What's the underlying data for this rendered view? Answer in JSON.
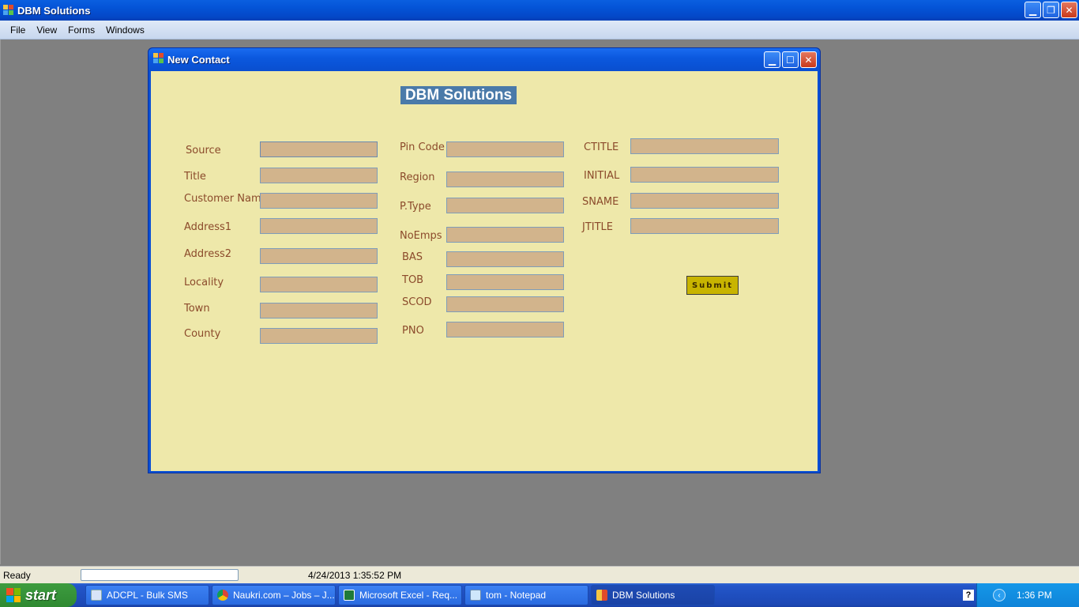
{
  "app": {
    "title": "DBM Solutions",
    "menu": [
      "File",
      "View",
      "Forms",
      "Windows"
    ]
  },
  "child": {
    "title": "New Contact",
    "heading": "DBM Solutions",
    "submit_label": "Submit",
    "fields_col1": [
      {
        "label": "Source",
        "value": ""
      },
      {
        "label": "Title",
        "value": ""
      },
      {
        "label": "Customer Name",
        "value": ""
      },
      {
        "label": "Address1",
        "value": ""
      },
      {
        "label": "Address2",
        "value": ""
      },
      {
        "label": "Locality",
        "value": ""
      },
      {
        "label": "Town",
        "value": ""
      },
      {
        "label": "County",
        "value": ""
      }
    ],
    "fields_col2": [
      {
        "label": "Pin Code",
        "value": ""
      },
      {
        "label": "Region",
        "value": ""
      },
      {
        "label": "P.Type",
        "value": ""
      },
      {
        "label": "NoEmps",
        "value": ""
      },
      {
        "label": "BAS",
        "value": ""
      },
      {
        "label": "TOB",
        "value": ""
      },
      {
        "label": "SCOD",
        "value": ""
      },
      {
        "label": "PNO",
        "value": ""
      }
    ],
    "fields_col3": [
      {
        "label": "CTITLE",
        "value": ""
      },
      {
        "label": "INITIAL",
        "value": ""
      },
      {
        "label": "SNAME",
        "value": ""
      },
      {
        "label": "JTITLE",
        "value": ""
      }
    ]
  },
  "status": {
    "text": "Ready",
    "datetime": "4/24/2013 1:35:52 PM"
  },
  "taskbar": {
    "start_label": "start",
    "items": [
      {
        "label": "ADCPL - Bulk SMS",
        "icon": "window-icon"
      },
      {
        "label": "Naukri.com – Jobs – J...",
        "icon": "chrome-icon"
      },
      {
        "label": "Microsoft Excel - Req...",
        "icon": "excel-icon"
      },
      {
        "label": "tom - Notepad",
        "icon": "notepad-icon"
      },
      {
        "label": "DBM Solutions",
        "icon": "app-icon"
      }
    ],
    "clock": "1:36 PM"
  },
  "colors": {
    "form_bg": "#eee8aa",
    "input_bg": "#d2b48c",
    "label": "#8b4a2b",
    "heading_bg": "#4a7aa9",
    "submit_bg": "#c8b400"
  }
}
